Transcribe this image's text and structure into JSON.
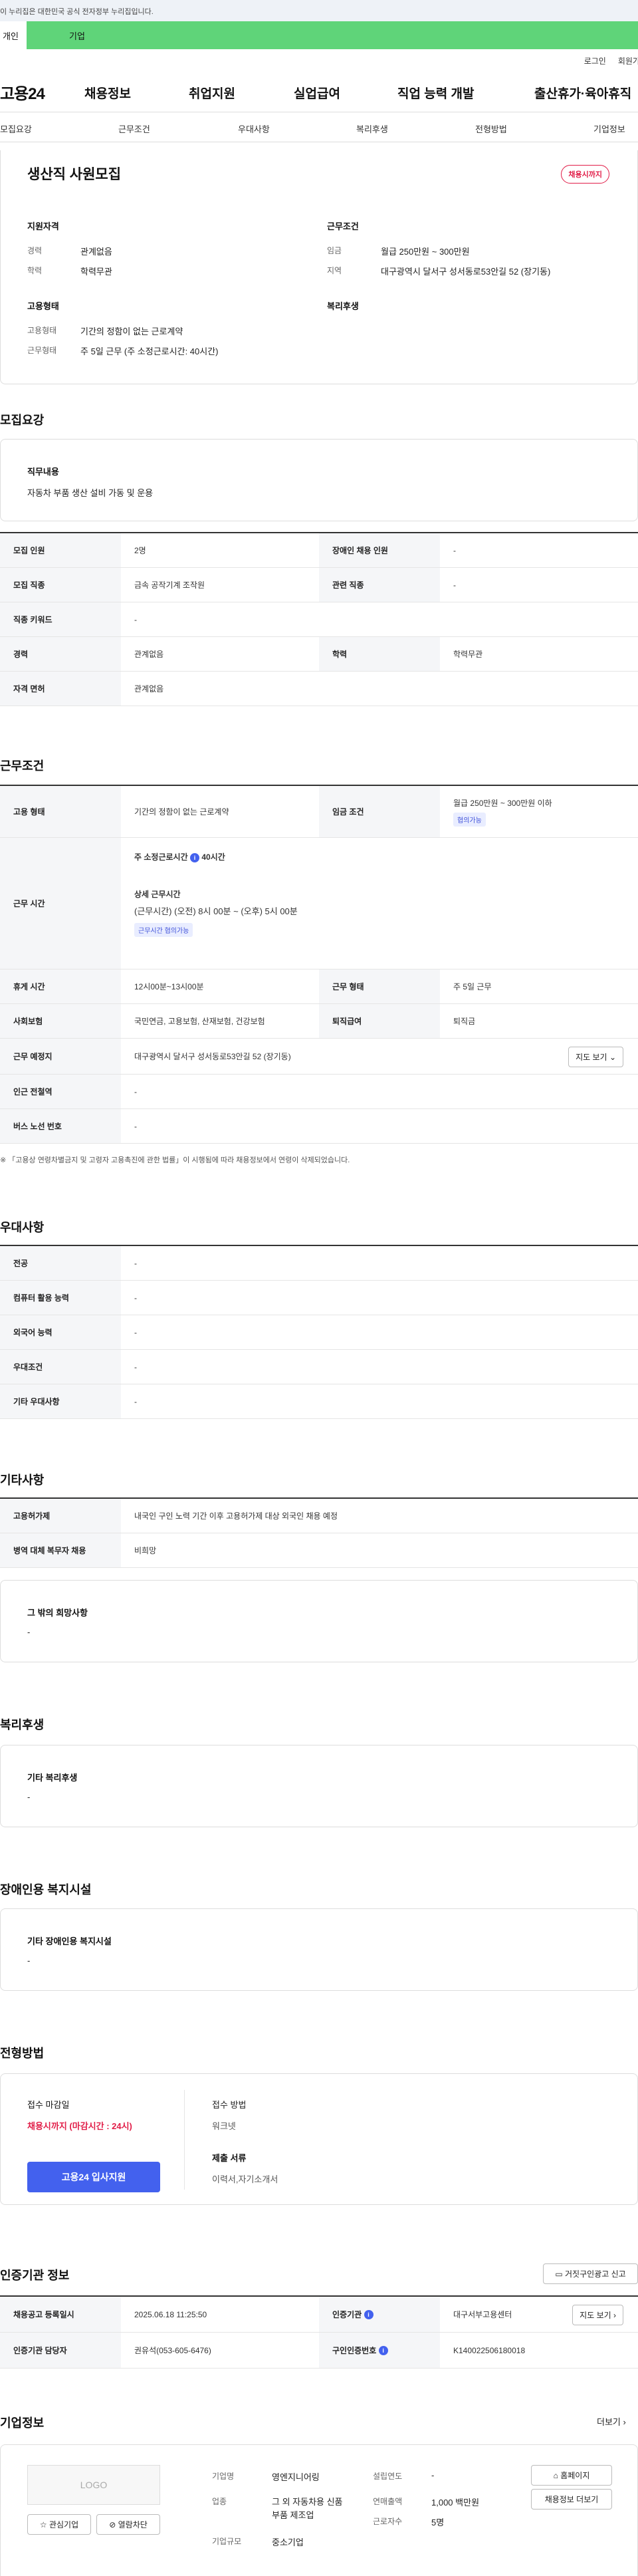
{
  "banner": "이 누리집은 대한민국 공식 전자정부 누리집입니다.",
  "user_tabs": [
    "개인",
    "기업"
  ],
  "util": [
    "로그인",
    "회원가입"
  ],
  "logo": "고용24",
  "gnb": [
    "채용정보",
    "취업지원",
    "실업급여",
    "직업 능력 개발",
    "출산휴가·육아휴직"
  ],
  "anchors": [
    "모집요강",
    "근무조건",
    "우대사항",
    "복리후생",
    "전형방법",
    "기업정보"
  ],
  "job_title": "생산직 사원모집",
  "deadline_badge": "채용시까지",
  "summary": {
    "qual_title": "지원자격",
    "exp_lbl": "경력",
    "exp": "관계없음",
    "edu_lbl": "학력",
    "edu": "학력무관",
    "cond_title": "근무조건",
    "wage_lbl": "임금",
    "wage": "월급 250만원 ~ 300만원",
    "loc_lbl": "지역",
    "loc": "대구광역시 달서구 성서동로53안길 52 (장기동)",
    "emp_title": "고용형태",
    "emptype_lbl": "고용형태",
    "emptype": "기간의 정함이 없는 근로계약",
    "worktype_lbl": "근무형태",
    "worktype": "주 5일 근무 (주 소정근로시간: 40시간)",
    "welfare_title": "복리후생"
  },
  "recruit": {
    "title": "모집요강",
    "duty_title": "직무내용",
    "duty": "자동차 부품 생산 설비 가동 및 운용",
    "rows": [
      [
        "모집 인원",
        "2명",
        "장애인 채용 인원",
        "-"
      ],
      [
        "모집 직종",
        "금속 공작기계 조작원",
        "관련 직종",
        "-"
      ],
      [
        "직종 키워드",
        "-"
      ],
      [
        "경력",
        "관계없음",
        "학력",
        "학력무관"
      ],
      [
        "자격 면허",
        "관계없음"
      ]
    ]
  },
  "work": {
    "title": "근무조건",
    "emp_lbl": "고용 형태",
    "emp": "기간의 정함이 없는 근로계약",
    "wage_lbl": "임금 조건",
    "wage": "월급 250만원 ~ 300만원 이하",
    "wage_tag": "협의가능",
    "hours_lbl": "근무 시간",
    "hours_weekly": "주 소정근로시간",
    "hours_weekly_val": "40시간",
    "hours_detail_title": "상세 근무시간",
    "hours_detail": "(근무시간) (오전) 8시 00분 ~ (오후) 5시 00분",
    "hours_tag": "근무시간 협의가능",
    "rest_lbl": "휴게 시간",
    "rest": "12시00분~13시00분",
    "form_lbl": "근무 형태",
    "form": "주 5일 근무",
    "ins_lbl": "사회보험",
    "ins": "국민연금, 고용보험, 산재보험, 건강보험",
    "ret_lbl": "퇴직급여",
    "ret": "퇴직금",
    "place_lbl": "근무 예정지",
    "place": "대구광역시 달서구 성서동로53안길 52 (장기동)",
    "map_btn": "지도 보기",
    "subway_lbl": "인근 전철역",
    "subway": "-",
    "bus_lbl": "버스 노선 번호",
    "bus": "-",
    "note": "※ 「고용상 연령차별금지 및 고령자 고용촉진에 관한 법률」이 시행됨에 따라 채용정보에서 연령이 삭제되었습니다."
  },
  "pref": {
    "title": "우대사항",
    "rows": [
      [
        "전공",
        "-"
      ],
      [
        "컴퓨터 활용 능력",
        "-"
      ],
      [
        "외국어 능력",
        "-"
      ],
      [
        "우대조건",
        "-"
      ],
      [
        "기타 우대사항",
        "-"
      ]
    ]
  },
  "etc": {
    "title": "기타사항",
    "rows": [
      [
        "고용허가제",
        "내국인 구인 노력 기간 이후 고용허가제 대상 외국인 채용 예정"
      ],
      [
        "병역 대체 복무자 채용",
        "비희망"
      ]
    ],
    "hope_title": "그 밖의 희망사항",
    "hope": "-"
  },
  "welfare": {
    "title": "복리후생",
    "sub": "기타 복리후생",
    "val": "-"
  },
  "disabled": {
    "title": "장애인용 복지시설",
    "sub": "기타 장애인용 복지시설",
    "val": "-"
  },
  "apply": {
    "title": "전형방법",
    "deadline_lbl": "접수 마감일",
    "deadline": "채용시까지 (마감시간 : 24시)",
    "btn": "고용24 입사지원",
    "method_lbl": "접수 방법",
    "method": "워크넷",
    "docs_lbl": "제출 서류",
    "docs": "이력서,자기소개서"
  },
  "agency": {
    "title": "인증기관 정보",
    "report_btn": "거짓구인광고 신고",
    "reg_lbl": "채용공고 등록일시",
    "reg": "2025.06.18 11:25:50",
    "org_lbl": "인증기관",
    "org": "대구서부고용센터",
    "map_btn": "지도 보기",
    "mgr_lbl": "인증기관 담당자",
    "mgr": "권유석(053-605-6476)",
    "num_lbl": "구인인증번호",
    "num": "K140022506180018"
  },
  "company": {
    "title": "기업정보",
    "more": "더보기",
    "logo": "LOGO",
    "fav_btn": "관심기업",
    "block_btn": "열람차단",
    "name_lbl": "기업명",
    "name": "영엔지니어링",
    "biz_lbl": "업종",
    "biz": "그 외 자동차용 신품 부품 제조업",
    "size_lbl": "기업규모",
    "size": "중소기업",
    "year_lbl": "설립연도",
    "year": "-",
    "sales_lbl": "연매출액",
    "sales": "1,000 백만원",
    "emp_lbl": "근로자수",
    "emp": "5명",
    "home_btn": "홈페이지",
    "other_btn": "채용정보 더보기"
  }
}
